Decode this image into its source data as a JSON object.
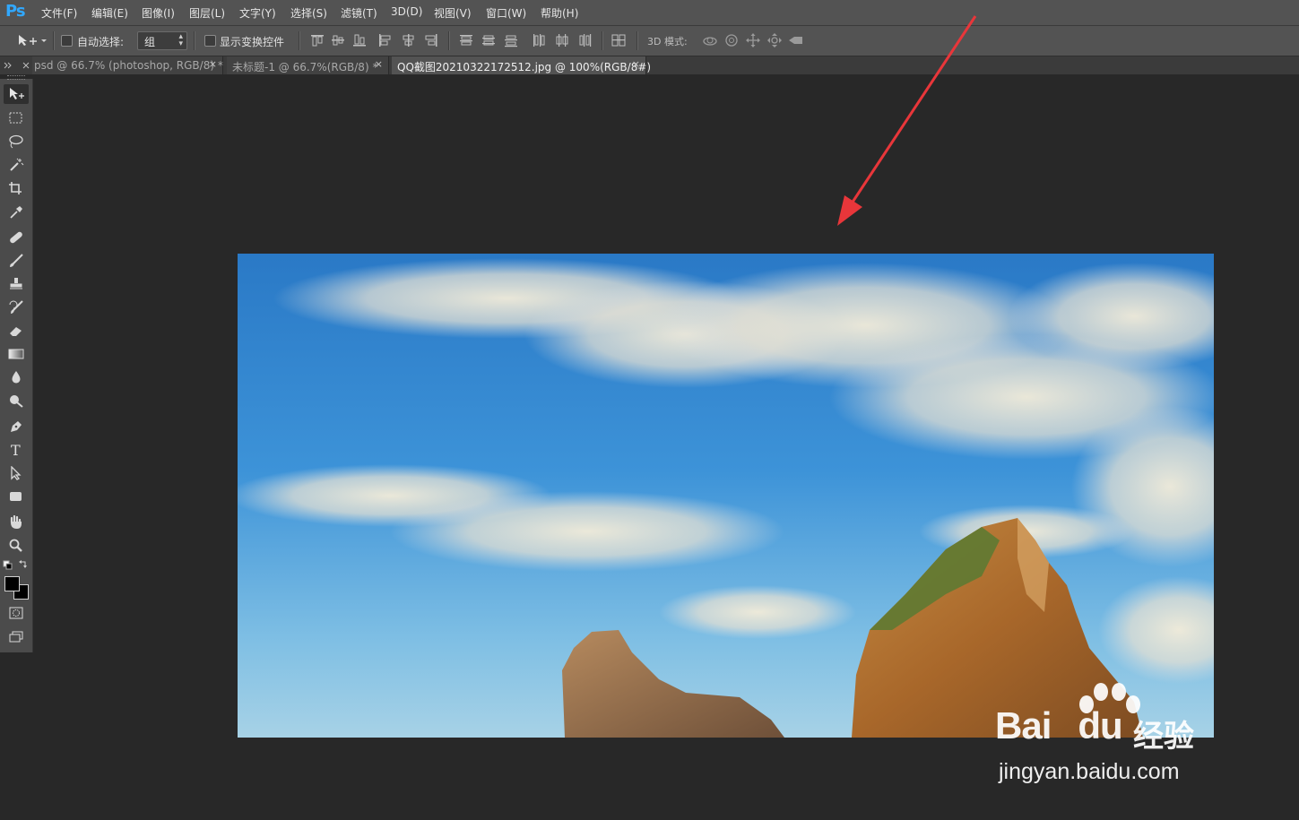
{
  "app": {
    "logo": "Ps"
  },
  "menu": [
    {
      "label": "文件(F)"
    },
    {
      "label": "编辑(E)"
    },
    {
      "label": "图像(I)"
    },
    {
      "label": "图层(L)"
    },
    {
      "label": "文字(Y)"
    },
    {
      "label": "选择(S)"
    },
    {
      "label": "滤镜(T)"
    },
    {
      "label": "3D(D)"
    },
    {
      "label": "视图(V)"
    },
    {
      "label": "窗口(W)"
    },
    {
      "label": "帮助(H)"
    }
  ],
  "options": {
    "auto_select_label": "自动选择:",
    "auto_select_value": "组",
    "show_transform_label": "显示变换控件",
    "mode_3d_label": "3D 模式:"
  },
  "tabs": [
    {
      "label": "psd @ 66.7% (photoshop, RGB/8) *",
      "close": "×"
    },
    {
      "label": "未标题-1 @ 66.7%(RGB/8) *",
      "close": "×"
    },
    {
      "label": "QQ截图20210322172512.jpg @ 100%(RGB/8#)",
      "close": "×",
      "active": true
    }
  ],
  "tools": [
    "move-tool",
    "marquee-tool",
    "lasso-tool",
    "magic-wand-tool",
    "crop-tool",
    "eyedropper-tool",
    "healing-brush-tool",
    "brush-tool",
    "clone-stamp-tool",
    "history-brush-tool",
    "eraser-tool",
    "gradient-tool",
    "blur-tool",
    "dodge-tool",
    "pen-tool",
    "type-tool",
    "path-selection-tool",
    "rectangle-tool",
    "hand-tool",
    "zoom-tool"
  ],
  "colors": {
    "foreground": "#000000",
    "background": "#000000",
    "arrow": "#e8363a"
  },
  "watermark": {
    "brand": "Bai",
    "brand2": "du",
    "jingyan": "经验",
    "url": "jingyan.baidu.com"
  }
}
